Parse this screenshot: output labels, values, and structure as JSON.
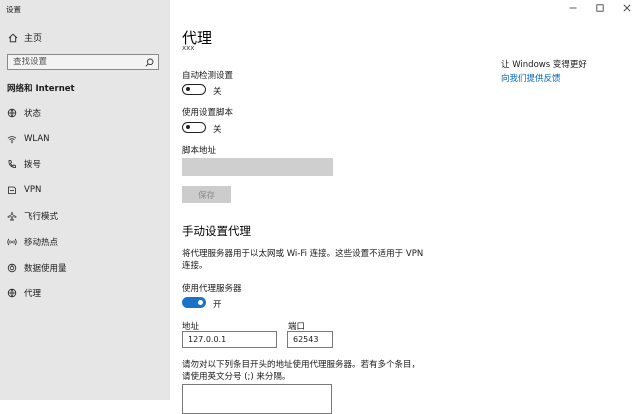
{
  "window": {
    "title": "设置"
  },
  "sidebar": {
    "home_label": "主页",
    "search_placeholder": "查找设置",
    "section_title": "网络和 Internet",
    "items": [
      {
        "label": "状态",
        "icon": "status-globe-icon"
      },
      {
        "label": "WLAN",
        "icon": "wifi-icon"
      },
      {
        "label": "拨号",
        "icon": "dialup-phone-icon"
      },
      {
        "label": "VPN",
        "icon": "vpn-icon"
      },
      {
        "label": "飞行模式",
        "icon": "airplane-icon"
      },
      {
        "label": "移动热点",
        "icon": "hotspot-icon"
      },
      {
        "label": "数据使用量",
        "icon": "data-usage-icon"
      },
      {
        "label": "代理",
        "icon": "globe-icon"
      }
    ]
  },
  "main": {
    "page_title": "代理",
    "cut_text": "xxx",
    "auto_detect": {
      "label": "自动检测设置",
      "state": "关"
    },
    "setup_script": {
      "label": "使用设置脚本",
      "state": "关"
    },
    "script_address": {
      "label": "脚本地址",
      "value": ""
    },
    "save_label": "保存",
    "manual": {
      "heading": "手动设置代理",
      "description": "将代理服务器用于以太网或 Wi-Fi 连接。这些设置不适用于 VPN 连接。",
      "use_proxy": {
        "label": "使用代理服务器",
        "state": "开"
      },
      "address_label": "地址",
      "address_value": "127.0.0.1",
      "port_label": "端口",
      "port_value": "62543",
      "exceptions_description": "请勿对以下列条目开头的地址使用代理服务器。若有多个条目，请使用英文分号 (;) 来分隔。",
      "exceptions_value": ""
    }
  },
  "side_panel": {
    "heading": "让 Windows 变得更好",
    "link": "向我们提供反馈"
  },
  "colors": {
    "accent": "#1a73c9",
    "link": "#0067c0",
    "sidebar_bg": "#e6e6e6"
  }
}
